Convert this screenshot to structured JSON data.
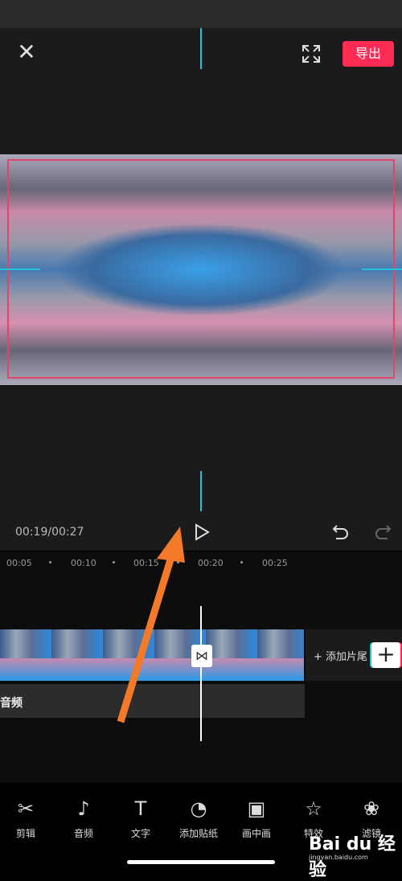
{
  "header": {
    "close_icon": "close-icon",
    "fullscreen_icon": "fullscreen-icon",
    "export_label": "导出",
    "export_color": "#fe2c55"
  },
  "player": {
    "time": "00:19/00:27",
    "play_icon": "play-icon",
    "undo_icon": "undo-icon",
    "redo_icon": "redo-icon"
  },
  "ruler": {
    "ticks": [
      "00:05",
      "00:10",
      "00:15",
      "00:20",
      "00:25"
    ]
  },
  "timeline": {
    "add_ending": "+ 添加片尾",
    "add_clip": "+",
    "audio_label": "音频",
    "transition_icon": "transition-icon"
  },
  "toolbar": {
    "items": [
      {
        "label": "剪辑",
        "icon": "scissors-icon"
      },
      {
        "label": "音频",
        "icon": "music-note-icon"
      },
      {
        "label": "文字",
        "icon": "text-icon"
      },
      {
        "label": "添加贴纸",
        "icon": "sticker-icon"
      },
      {
        "label": "画中画",
        "icon": "picture-in-picture-icon"
      },
      {
        "label": "特效",
        "icon": "star-wand-icon"
      },
      {
        "label": "滤镜",
        "icon": "filter-icon"
      }
    ]
  },
  "watermark": {
    "brand": "Bai du 经验",
    "url": "jingyan.baidu.com"
  },
  "accent": "#21c4d8"
}
